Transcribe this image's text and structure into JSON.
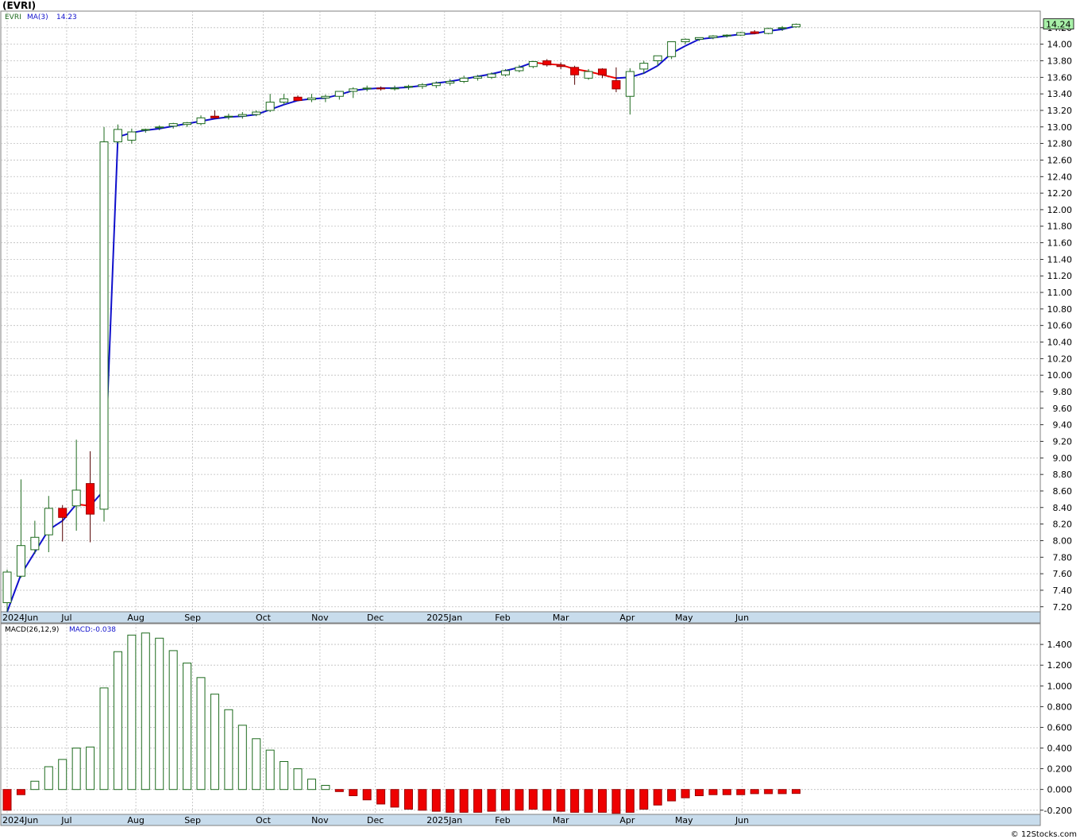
{
  "title": "(EVRI)",
  "credit": "© 12Stocks.com",
  "price_panel": {
    "legend_symbol": "EVRI",
    "legend_ma_name": "MA(3)",
    "legend_ma_value": "14.23",
    "last_price_label": "14.24"
  },
  "macd_panel": {
    "legend_name": "MACD(26,12,9)",
    "legend_value": "MACD:-0.038"
  },
  "colors": {
    "up_candle": "#1e6b1e",
    "down_candle": "#ee0000",
    "ma_up": "#1010cc",
    "ma_down": "#ee0000",
    "grid": "#bdbdbd",
    "axis_band": "#c8dcec",
    "last_price_bg": "#a8f0a8"
  },
  "chart_data": [
    {
      "type": "candlestick",
      "title": "(EVRI)",
      "ylim": [
        7.14,
        14.4
      ],
      "yticks": [
        "7.20",
        "7.40",
        "7.60",
        "7.80",
        "8.00",
        "8.20",
        "8.40",
        "8.60",
        "8.80",
        "9.00",
        "9.20",
        "9.40",
        "9.60",
        "9.80",
        "10.00",
        "10.20",
        "10.40",
        "10.60",
        "10.80",
        "11.00",
        "11.20",
        "11.40",
        "11.60",
        "11.80",
        "12.00",
        "12.20",
        "12.40",
        "12.60",
        "12.80",
        "13.00",
        "13.20",
        "13.40",
        "13.60",
        "13.80",
        "14.00",
        "14.20"
      ],
      "xtick_labels": [
        "2024Jun",
        "Jul",
        "Aug",
        "Sep",
        "Oct",
        "Nov",
        "Dec",
        "2025Jan",
        "Feb",
        "Mar",
        "Apr",
        "May",
        "Jun"
      ],
      "xtick_index": [
        0,
        4.3,
        9.3,
        13.4,
        18.5,
        22.6,
        26.6,
        31.6,
        35.8,
        40.0,
        44.8,
        48.9,
        53.1
      ],
      "grid": true,
      "candles": [
        {
          "o": 7.25,
          "h": 7.65,
          "l": 7.14,
          "c": 7.62
        },
        {
          "o": 7.57,
          "h": 8.74,
          "l": 7.55,
          "c": 7.94
        },
        {
          "o": 7.89,
          "h": 8.24,
          "l": 7.84,
          "c": 8.04
        },
        {
          "o": 8.07,
          "h": 8.54,
          "l": 7.86,
          "c": 8.39
        },
        {
          "o": 8.39,
          "h": 8.43,
          "l": 7.99,
          "c": 8.28
        },
        {
          "o": 8.42,
          "h": 9.22,
          "l": 8.12,
          "c": 8.61
        },
        {
          "o": 8.69,
          "h": 9.08,
          "l": 7.98,
          "c": 8.32
        },
        {
          "o": 8.38,
          "h": 13.0,
          "l": 8.23,
          "c": 12.82
        },
        {
          "o": 12.82,
          "h": 13.03,
          "l": 12.8,
          "c": 12.97
        },
        {
          "o": 12.84,
          "h": 12.98,
          "l": 12.8,
          "c": 12.94
        },
        {
          "o": 12.96,
          "h": 12.98,
          "l": 12.93,
          "c": 12.97
        },
        {
          "o": 12.99,
          "h": 13.02,
          "l": 12.96,
          "c": 13.0
        },
        {
          "o": 13.01,
          "h": 13.05,
          "l": 12.98,
          "c": 13.04
        },
        {
          "o": 13.03,
          "h": 13.06,
          "l": 13.0,
          "c": 13.05
        },
        {
          "o": 13.04,
          "h": 13.14,
          "l": 13.02,
          "c": 13.11
        },
        {
          "o": 13.13,
          "h": 13.2,
          "l": 13.1,
          "c": 13.11
        },
        {
          "o": 13.12,
          "h": 13.16,
          "l": 13.09,
          "c": 13.13
        },
        {
          "o": 13.13,
          "h": 13.18,
          "l": 13.1,
          "c": 13.15
        },
        {
          "o": 13.15,
          "h": 13.2,
          "l": 13.13,
          "c": 13.18
        },
        {
          "o": 13.2,
          "h": 13.4,
          "l": 13.18,
          "c": 13.3
        },
        {
          "o": 13.3,
          "h": 13.4,
          "l": 13.27,
          "c": 13.34
        },
        {
          "o": 13.36,
          "h": 13.38,
          "l": 13.31,
          "c": 13.32
        },
        {
          "o": 13.33,
          "h": 13.4,
          "l": 13.3,
          "c": 13.35
        },
        {
          "o": 13.35,
          "h": 13.39,
          "l": 13.3,
          "c": 13.37
        },
        {
          "o": 13.37,
          "h": 13.42,
          "l": 13.33,
          "c": 13.43
        },
        {
          "o": 13.43,
          "h": 13.48,
          "l": 13.35,
          "c": 13.46
        },
        {
          "o": 13.46,
          "h": 13.5,
          "l": 13.43,
          "c": 13.47
        },
        {
          "o": 13.47,
          "h": 13.49,
          "l": 13.44,
          "c": 13.46
        },
        {
          "o": 13.47,
          "h": 13.5,
          "l": 13.44,
          "c": 13.47
        },
        {
          "o": 13.48,
          "h": 13.51,
          "l": 13.45,
          "c": 13.49
        },
        {
          "o": 13.49,
          "h": 13.53,
          "l": 13.46,
          "c": 13.51
        },
        {
          "o": 13.5,
          "h": 13.55,
          "l": 13.47,
          "c": 13.53
        },
        {
          "o": 13.53,
          "h": 13.58,
          "l": 13.5,
          "c": 13.55
        },
        {
          "o": 13.55,
          "h": 13.62,
          "l": 13.53,
          "c": 13.59
        },
        {
          "o": 13.59,
          "h": 13.63,
          "l": 13.56,
          "c": 13.61
        },
        {
          "o": 13.6,
          "h": 13.66,
          "l": 13.58,
          "c": 13.64
        },
        {
          "o": 13.63,
          "h": 13.7,
          "l": 13.61,
          "c": 13.68
        },
        {
          "o": 13.68,
          "h": 13.75,
          "l": 13.66,
          "c": 13.72
        },
        {
          "o": 13.73,
          "h": 13.8,
          "l": 13.71,
          "c": 13.79
        },
        {
          "o": 13.8,
          "h": 13.82,
          "l": 13.73,
          "c": 13.75
        },
        {
          "o": 13.75,
          "h": 13.78,
          "l": 13.7,
          "c": 13.73
        },
        {
          "o": 13.72,
          "h": 13.74,
          "l": 13.51,
          "c": 13.63
        },
        {
          "o": 13.59,
          "h": 13.7,
          "l": 13.57,
          "c": 13.67
        },
        {
          "o": 13.7,
          "h": 13.71,
          "l": 13.59,
          "c": 13.63
        },
        {
          "o": 13.56,
          "h": 13.72,
          "l": 13.42,
          "c": 13.46
        },
        {
          "o": 13.37,
          "h": 13.71,
          "l": 13.15,
          "c": 13.67
        },
        {
          "o": 13.7,
          "h": 13.8,
          "l": 13.64,
          "c": 13.77
        },
        {
          "o": 13.8,
          "h": 13.86,
          "l": 13.74,
          "c": 13.86
        },
        {
          "o": 13.85,
          "h": 14.03,
          "l": 13.82,
          "c": 14.03
        },
        {
          "o": 14.03,
          "h": 14.07,
          "l": 14.0,
          "c": 14.06
        },
        {
          "o": 14.06,
          "h": 14.08,
          "l": 14.04,
          "c": 14.08
        },
        {
          "o": 14.08,
          "h": 14.11,
          "l": 14.06,
          "c": 14.1
        },
        {
          "o": 14.1,
          "h": 14.12,
          "l": 14.08,
          "c": 14.11
        },
        {
          "o": 14.11,
          "h": 14.15,
          "l": 14.1,
          "c": 14.14
        },
        {
          "o": 14.15,
          "h": 14.17,
          "l": 14.12,
          "c": 14.13
        },
        {
          "o": 14.13,
          "h": 14.2,
          "l": 14.12,
          "c": 14.19
        },
        {
          "o": 14.19,
          "h": 14.22,
          "l": 14.16,
          "c": 14.2
        },
        {
          "o": 14.21,
          "h": 14.25,
          "l": 14.2,
          "c": 14.24
        }
      ],
      "ma3": [
        7.14,
        7.59,
        7.86,
        8.13,
        8.24,
        8.44,
        8.42,
        8.61,
        12.88,
        12.93,
        12.96,
        12.98,
        13.01,
        13.04,
        13.07,
        13.1,
        13.12,
        13.13,
        13.15,
        13.21,
        13.27,
        13.32,
        13.34,
        13.35,
        13.39,
        13.44,
        13.46,
        13.47,
        13.47,
        13.48,
        13.5,
        13.53,
        13.55,
        13.58,
        13.61,
        13.64,
        13.68,
        13.72,
        13.78,
        13.76,
        13.75,
        13.7,
        13.67,
        13.63,
        13.59,
        13.6,
        13.65,
        13.74,
        13.89,
        13.98,
        14.06,
        14.08,
        14.1,
        14.12,
        14.13,
        14.16,
        14.18,
        14.22
      ]
    },
    {
      "type": "bar",
      "title": "MACD(26,12,9)",
      "ylim": [
        -0.24,
        1.6
      ],
      "yticks": [
        "-0.200",
        "0.000",
        "0.200",
        "0.400",
        "0.600",
        "0.800",
        "1.000",
        "1.200",
        "1.400"
      ],
      "xtick_labels": [
        "2024Jun",
        "Jul",
        "Aug",
        "Sep",
        "Oct",
        "Nov",
        "Dec",
        "2025Jan",
        "Feb",
        "Mar",
        "Apr",
        "May",
        "Jun"
      ],
      "xtick_index": [
        0,
        4.3,
        9.3,
        13.4,
        18.5,
        22.6,
        26.6,
        31.6,
        35.8,
        40.0,
        44.8,
        48.9,
        53.1
      ],
      "grid": true,
      "values": [
        -0.2,
        -0.05,
        0.08,
        0.22,
        0.29,
        0.4,
        0.41,
        0.98,
        1.33,
        1.49,
        1.51,
        1.46,
        1.34,
        1.22,
        1.08,
        0.92,
        0.77,
        0.62,
        0.49,
        0.38,
        0.27,
        0.2,
        0.1,
        0.04,
        -0.02,
        -0.06,
        -0.1,
        -0.14,
        -0.17,
        -0.19,
        -0.2,
        -0.21,
        -0.22,
        -0.22,
        -0.22,
        -0.21,
        -0.2,
        -0.2,
        -0.19,
        -0.2,
        -0.21,
        -0.22,
        -0.22,
        -0.22,
        -0.23,
        -0.22,
        -0.19,
        -0.15,
        -0.11,
        -0.08,
        -0.06,
        -0.05,
        -0.05,
        -0.05,
        -0.04,
        -0.04,
        -0.04,
        -0.038
      ]
    }
  ]
}
